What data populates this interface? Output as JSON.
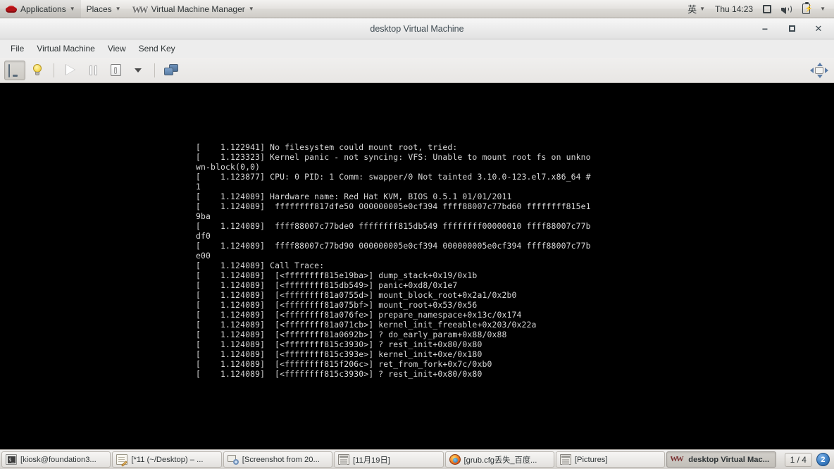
{
  "top_panel": {
    "logo_icon": "redhat-fedora-icon",
    "menus": [
      {
        "label": "Applications",
        "icon": "redhat-fedora-icon",
        "has_caret": true
      },
      {
        "label": "Places",
        "icon": null,
        "has_caret": true
      },
      {
        "label": "Virtual Machine Manager",
        "icon": "vmm-logo-icon",
        "has_caret": true
      }
    ],
    "tray": {
      "ime_label": "英",
      "ime_caret": true,
      "clock": "Thu 14:23",
      "display_icon": "display-icon",
      "volume_icon": "speaker-icon",
      "battery_icon": "battery-icon",
      "battery_glyph": "⚡",
      "menu_caret": true
    }
  },
  "window": {
    "title": "desktop Virtual Machine",
    "controls": {
      "minimize": "−",
      "maximize": "",
      "close": "✕"
    },
    "menubar": [
      "File",
      "Virtual Machine",
      "View",
      "Send Key"
    ],
    "toolbar": [
      {
        "name": "console-view-button",
        "icon": "monitor-icon",
        "state": "active",
        "enabled": true
      },
      {
        "name": "show-details-button",
        "icon": "lightbulb-icon",
        "state": "normal",
        "enabled": true
      },
      {
        "name": "separator-1",
        "icon": "separator",
        "state": "none",
        "enabled": false
      },
      {
        "name": "run-button",
        "icon": "play-icon",
        "state": "disabled",
        "enabled": false
      },
      {
        "name": "pause-button",
        "icon": "pause-icon",
        "state": "normal",
        "enabled": true
      },
      {
        "name": "shutdown-button",
        "icon": "power-icon",
        "state": "normal",
        "enabled": true
      },
      {
        "name": "shutdown-dropdown-button",
        "icon": "chevron-down-icon",
        "state": "normal",
        "enabled": true
      },
      {
        "name": "separator-2",
        "icon": "separator",
        "state": "none",
        "enabled": false
      },
      {
        "name": "snapshots-button",
        "icon": "screens-icon",
        "state": "normal",
        "enabled": true
      },
      {
        "name": "fullscreen-button",
        "icon": "fullscreen-icon",
        "state": "normal",
        "enabled": true
      }
    ]
  },
  "console": {
    "background_color": "#000000",
    "text_color": "#d8d8d8",
    "lines": [
      "[    1.122941] No filesystem could mount root, tried:",
      "[    1.123323] Kernel panic - not syncing: VFS: Unable to mount root fs on unkno",
      "wn-block(0,0)",
      "[    1.123877] CPU: 0 PID: 1 Comm: swapper/0 Not tainted 3.10.0-123.el7.x86_64 #",
      "1",
      "[    1.124089] Hardware name: Red Hat KVM, BIOS 0.5.1 01/01/2011",
      "[    1.124089]  ffffffff817dfe50 000000005e0cf394 ffff88007c77bd60 ffffffff815e1",
      "9ba",
      "[    1.124089]  ffff88007c77bde0 ffffffff815db549 ffffffff00000010 ffff88007c77b",
      "df0",
      "[    1.124089]  ffff88007c77bd90 000000005e0cf394 000000005e0cf394 ffff88007c77b",
      "e00",
      "[    1.124089] Call Trace:",
      "[    1.124089]  [<ffffffff815e19ba>] dump_stack+0x19/0x1b",
      "[    1.124089]  [<ffffffff815db549>] panic+0xd8/0x1e7",
      "[    1.124089]  [<ffffffff81a0755d>] mount_block_root+0x2a1/0x2b0",
      "[    1.124089]  [<ffffffff81a075bf>] mount_root+0x53/0x56",
      "[    1.124089]  [<ffffffff81a076fe>] prepare_namespace+0x13c/0x174",
      "[    1.124089]  [<ffffffff81a071cb>] kernel_init_freeable+0x203/0x22a",
      "[    1.124089]  [<ffffffff81a0692b>] ? do_early_param+0x88/0x88",
      "[    1.124089]  [<ffffffff815c3930>] ? rest_init+0x80/0x80",
      "[    1.124089]  [<ffffffff815c393e>] kernel_init+0xe/0x180",
      "[    1.124089]  [<ffffffff815f206c>] ret_from_fork+0x7c/0xb0",
      "[    1.124089]  [<ffffffff815c3930>] ? rest_init+0x80/0x80"
    ]
  },
  "taskbar": {
    "items": [
      {
        "label": "[kiosk@foundation3...",
        "icon": "terminal-icon",
        "active": false
      },
      {
        "label": "[*11 (~/Desktop) – ...",
        "icon": "gedit-icon",
        "active": false
      },
      {
        "label": "[Screenshot from 20...",
        "icon": "screenshot-icon",
        "active": false
      },
      {
        "label": "[11月19日]",
        "icon": "calendar-icon",
        "active": false
      },
      {
        "label": "[grub.cfg丢失_百度...",
        "icon": "firefox-icon",
        "active": false
      },
      {
        "label": "[Pictures]",
        "icon": "filemanager-icon",
        "active": false
      },
      {
        "label": "desktop Virtual Mac...",
        "icon": "vmm-logo-icon",
        "active": true
      }
    ],
    "workspace": {
      "count_label": "1 / 4",
      "badge_label": "2",
      "badge_color": "#3d7fc4"
    }
  }
}
